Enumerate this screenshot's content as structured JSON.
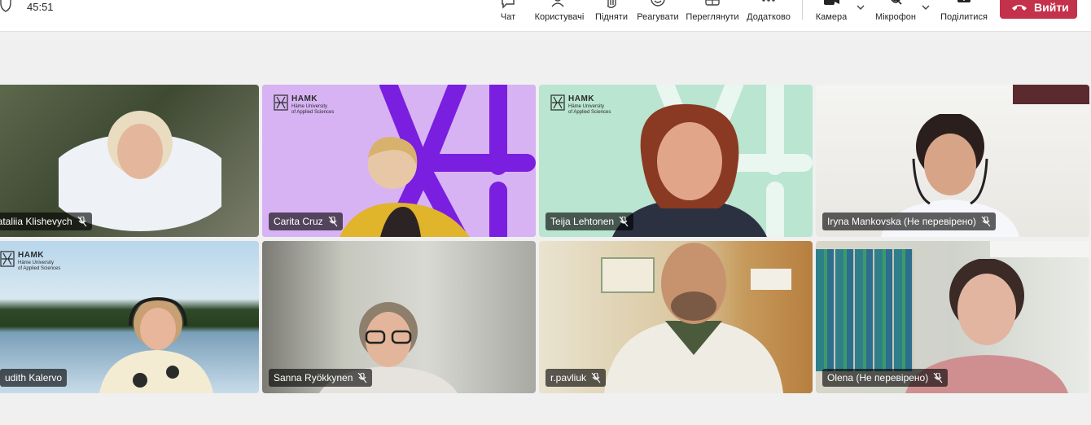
{
  "meeting": {
    "timer": "45:51",
    "toolbar": [
      {
        "id": "chat",
        "label": "Чат"
      },
      {
        "id": "people",
        "label": "Користувачі"
      },
      {
        "id": "raise",
        "label": "Підняти"
      },
      {
        "id": "react",
        "label": "Реагувати"
      },
      {
        "id": "view",
        "label": "Переглянути"
      },
      {
        "id": "more",
        "label": "Додатково"
      },
      {
        "id": "camera",
        "label": "Камера"
      },
      {
        "id": "mic",
        "label": "Мікрофон"
      },
      {
        "id": "share",
        "label": "Поділитися"
      }
    ],
    "leave_label": "Вийти",
    "colors": {
      "leave": "#c4314b",
      "active_speaker": "#7f6ce0",
      "hamk_purple": "#7a1fe0"
    }
  },
  "brand": {
    "name": "HAMK",
    "line1": "Häme University",
    "line2": "of Applied Sciences"
  },
  "participants": [
    {
      "name": "Nataliia Klishevych",
      "muted": true
    },
    {
      "name": "Carita Cruz",
      "muted": true,
      "active": true
    },
    {
      "name": "Teija Lehtonen",
      "muted": true
    },
    {
      "name": "Iryna Mankovska (Не перевірено)",
      "muted": true
    },
    {
      "name": "udith Kalervo",
      "muted": false
    },
    {
      "name": "Sanna Ryökkynen",
      "muted": true
    },
    {
      "name": "r.pavliuk",
      "muted": true
    },
    {
      "name": "Olena (Не перевірено)",
      "muted": true
    }
  ]
}
